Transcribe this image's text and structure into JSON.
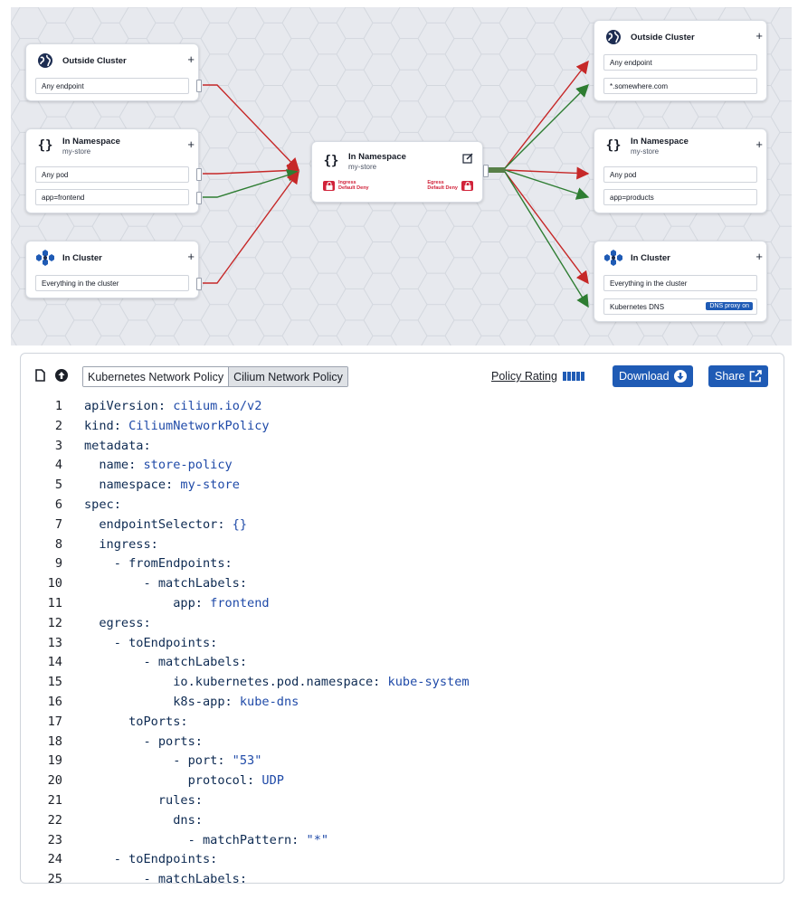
{
  "graph": {
    "left": {
      "outside_cluster": {
        "title": "Outside Cluster",
        "rows": [
          "Any endpoint"
        ]
      },
      "in_namespace": {
        "title": "In Namespace",
        "subtitle": "my-store",
        "rows": [
          "Any pod",
          "app=frontend"
        ]
      },
      "in_cluster": {
        "title": "In Cluster",
        "rows": [
          "Everything in the cluster"
        ]
      }
    },
    "center": {
      "title": "In Namespace",
      "subtitle": "my-store",
      "ingress_label": "Ingress",
      "ingress_sub": "Default Deny",
      "egress_label": "Egress",
      "egress_sub": "Default Deny"
    },
    "right": {
      "outside_cluster": {
        "title": "Outside Cluster",
        "rows": [
          "Any endpoint",
          "*.somewhere.com"
        ]
      },
      "in_namespace": {
        "title": "In Namespace",
        "subtitle": "my-store",
        "rows": [
          "Any pod",
          "app=products"
        ]
      },
      "in_cluster": {
        "title": "In Cluster",
        "rows": [
          "Everything in the cluster",
          "Kubernetes DNS"
        ],
        "dns_badge": "DNS proxy on"
      }
    },
    "plus_label": "+",
    "colors": {
      "deny": "#c62828",
      "allow": "#2e7d32",
      "accent": "#1f5bb5",
      "lock": "#d1233a"
    }
  },
  "toolbar": {
    "tabs": [
      "Kubernetes Network Policy",
      "Cilium Network Policy"
    ],
    "active_tab": "Cilium Network Policy",
    "policy_rating_label": "Policy Rating",
    "policy_rating_value": 5,
    "download_label": "Download",
    "share_label": "Share",
    "icons": [
      "new-file-icon",
      "upload-icon",
      "download-circle-icon",
      "external-link-icon"
    ]
  },
  "editor": {
    "lines": [
      "apiVersion: cilium.io/v2",
      "kind: CiliumNetworkPolicy",
      "metadata:",
      "  name: store-policy",
      "  namespace: my-store",
      "spec:",
      "  endpointSelector: {}",
      "  ingress:",
      "    - fromEndpoints:",
      "        - matchLabels:",
      "            app: frontend",
      "  egress:",
      "    - toEndpoints:",
      "        - matchLabels:",
      "            io.kubernetes.pod.namespace: kube-system",
      "            k8s-app: kube-dns",
      "      toPorts:",
      "        - ports:",
      "            - port: \"53\"",
      "              protocol: UDP",
      "          rules:",
      "            dns:",
      "              - matchPattern: \"*\"",
      "    - toEndpoints:",
      "        - matchLabels:"
    ]
  }
}
